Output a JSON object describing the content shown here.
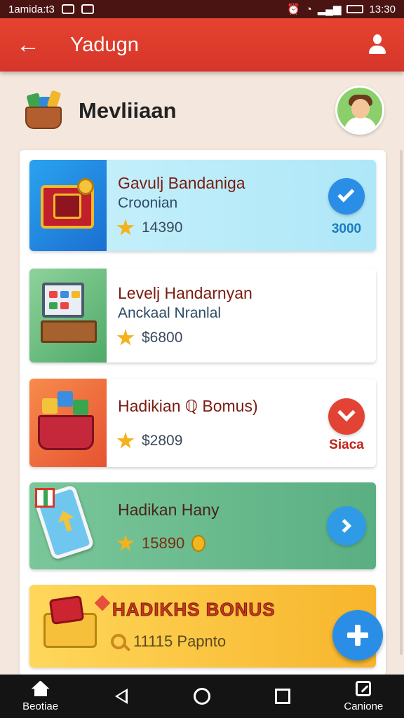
{
  "status_bar": {
    "left_text": "1amida:t3",
    "time": "13:30"
  },
  "app_bar": {
    "title": "Yadugn"
  },
  "header": {
    "title": "Mevliiaan"
  },
  "cards": [
    {
      "title": "Gavulj Bandaniga",
      "subtitle": "Croonian",
      "points": "14390",
      "side_value": "3000"
    },
    {
      "title": "Levelj Handarnyan",
      "subtitle": "Anckaal Nranlal",
      "points": "$6800"
    },
    {
      "title": "Hadikian ℚ Bomus)",
      "points": "$2809",
      "side_value": "Siaca"
    },
    {
      "title": "Hadikan Hany",
      "points": "15890"
    },
    {
      "title": "HADIKHS BONUS",
      "points": "11115 Papnto"
    }
  ],
  "nav": {
    "home_label": "Beotiae",
    "right_label": "Canione"
  },
  "colors": {
    "accent": "#e5432f",
    "blue": "#2a8ee7",
    "star": "#f5b21c"
  }
}
